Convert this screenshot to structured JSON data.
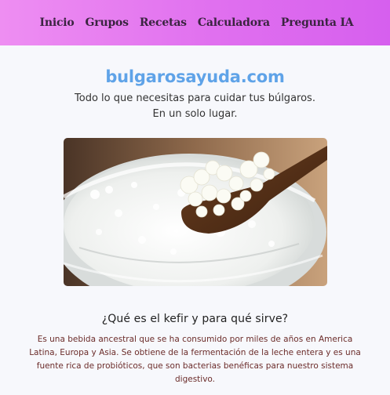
{
  "nav": {
    "items": [
      {
        "label": "Inicio"
      },
      {
        "label": "Grupos"
      },
      {
        "label": "Recetas"
      },
      {
        "label": "Calculadora"
      },
      {
        "label": "Pregunta IA"
      }
    ]
  },
  "hero": {
    "title": "bulgarosayuda.com",
    "tagline_line1": "Todo lo que necesitas para cuidar tus búlgaros.",
    "tagline_line2": "En un solo lugar."
  },
  "section": {
    "title": "¿Qué es el kefir y para qué sirve?",
    "body": "Es una bebida ancestral que se ha consumido por miles de años en America Latina, Europa y Asia. Se obtiene de la fermentación de la leche entera y es una fuente rica de probióticos, que son bacterias benéficas para nuestro sistema digestivo."
  },
  "colors": {
    "nav_gradient_start": "#ee8ef2",
    "nav_gradient_end": "#d65fee",
    "title_blue": "#5fa3e8",
    "body_text": "#6b2c2a"
  }
}
